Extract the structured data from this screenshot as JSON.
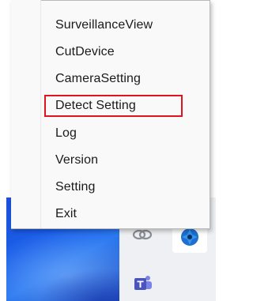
{
  "menu": {
    "items": [
      {
        "label": "SurveillanceView"
      },
      {
        "label": "CutDevice"
      },
      {
        "label": "CameraSetting"
      },
      {
        "label": "Detect Setting",
        "highlighted": true
      },
      {
        "label": "Log"
      },
      {
        "label": "Version"
      },
      {
        "label": "Setting"
      },
      {
        "label": "Exit"
      }
    ],
    "highlight_color": "#e0141e"
  },
  "tray": {
    "icons": [
      "link-icon",
      "bluetooth-icon",
      "teams-icon"
    ]
  }
}
